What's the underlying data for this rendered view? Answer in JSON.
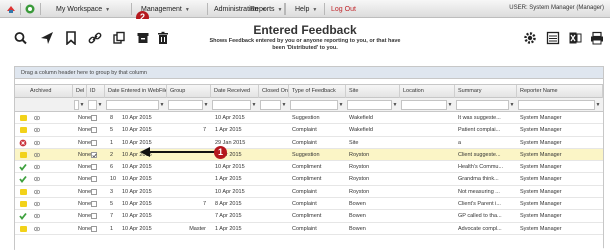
{
  "menubar": {
    "items": [
      {
        "label": "My Workspace"
      },
      {
        "label": "Management"
      },
      {
        "label": "Administration"
      },
      {
        "label": "Reports"
      },
      {
        "label": "Help"
      }
    ],
    "logout": "Log Out",
    "user": "USER: System Manager (Manager)"
  },
  "callouts": {
    "one": "1",
    "two": "2"
  },
  "page": {
    "title": "Entered Feedback",
    "subtitle_line1": "Shows Feedback entered by you or anyone reporting to you, or that have",
    "subtitle_line2": "been 'Distributed' to you."
  },
  "grid": {
    "group_hint": "Drag a column header here to group by that column",
    "columns": [
      "Archived",
      "Del",
      "ID",
      "Date Entered in WebFile",
      "Group",
      "Date Received",
      "Closed On",
      "Type of Feedback",
      "Site",
      "Location",
      "Summary",
      "Reporter Name"
    ],
    "rows": [
      {
        "status": "yellow",
        "del": "None",
        "id": "8",
        "entered": "10 Apr 2015",
        "group": "",
        "received": "10 Apr 2015",
        "type": "Suggestion",
        "site": "Wakefield",
        "summary": "It was suggeste...",
        "reporter": "System Manager"
      },
      {
        "status": "yellow",
        "del": "None",
        "id": "5",
        "entered": "10 Apr 2015",
        "group": "7",
        "received": "1 Apr 2015",
        "type": "Complaint",
        "site": "Wakefield",
        "summary": "Patient complai...",
        "reporter": "System Manager"
      },
      {
        "status": "red",
        "del": "None",
        "id": "1",
        "entered": "10 Apr 2015",
        "group": "",
        "received": "29 Jan 2015",
        "type": "Complaint",
        "site": "Site",
        "summary": "a",
        "reporter": "System Manager"
      },
      {
        "status": "yellow",
        "del": "None",
        "id": "2",
        "entered": "10 Apr 2015",
        "group": "",
        "received": "8 Apr 2015",
        "type": "Suggestion",
        "site": "Royston",
        "summary": "Client suggeste...",
        "reporter": "System Manager",
        "highlight": true
      },
      {
        "status": "green",
        "del": "None",
        "id": "6",
        "entered": "10 Apr 2015",
        "group": "",
        "received": "10 Apr 2015",
        "type": "Compliment",
        "site": "Royston",
        "summary": "Health's Commu...",
        "reporter": "System Manager"
      },
      {
        "status": "green",
        "del": "None",
        "id": "10",
        "entered": "10 Apr 2015",
        "group": "",
        "received": "1 Apr 2015",
        "type": "Compliment",
        "site": "Royston",
        "summary": "Grandma think...",
        "reporter": "System Manager"
      },
      {
        "status": "yellow",
        "del": "None",
        "id": "3",
        "entered": "10 Apr 2015",
        "group": "",
        "received": "10 Apr 2015",
        "type": "Complaint",
        "site": "Royston",
        "summary": "Not measuring ...",
        "reporter": "System Manager"
      },
      {
        "status": "yellow",
        "del": "None",
        "id": "5",
        "entered": "10 Apr 2015",
        "group": "7",
        "received": "8 Apr 2015",
        "type": "Complaint",
        "site": "Bowen",
        "summary": "Client's Parent i...",
        "reporter": "System Manager"
      },
      {
        "status": "green",
        "del": "None",
        "id": "7",
        "entered": "10 Apr 2015",
        "group": "",
        "received": "7 Apr 2015",
        "type": "Compliment",
        "site": "Bowen",
        "summary": "GP called to tha...",
        "reporter": "System Manager"
      },
      {
        "status": "yellow",
        "del": "None",
        "id": "1",
        "entered": "10 Apr 2015",
        "group": "Master",
        "received": "1 Apr 2015",
        "type": "Complaint",
        "site": "Bowen",
        "summary": "Advocate compl...",
        "reporter": "System Manager"
      }
    ]
  },
  "colors": {
    "accent": "#b5181e",
    "highlight": "#fbf5c6",
    "status_yellow": "#f2d21a",
    "status_green": "#3ea13e",
    "status_red": "#c9313a"
  }
}
